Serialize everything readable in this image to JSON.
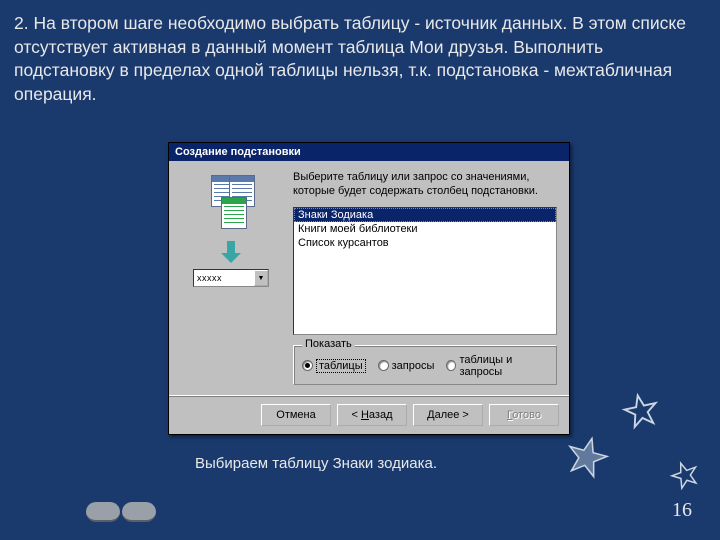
{
  "instruction": "2. На втором шаге необходимо выбрать таблицу - источник данных. В этом списке отсутствует активная в данный момент таблица Мои друзья. Выполнить подстановку в пределах одной таблицы нельзя, т.к. подстановка - межтабличная операция.",
  "dialog": {
    "title": "Создание подстановки",
    "prompt": "Выберите таблицу или запрос со значениями, которые будет содержать столбец подстановки.",
    "combo_placeholder": "xxxxx",
    "list": {
      "items": [
        "Знаки Зодиака",
        "Книги моей библиотеки",
        "Список курсантов"
      ],
      "selected_index": 0
    },
    "show_group": {
      "legend": "Показать",
      "options": [
        "таблицы",
        "запросы",
        "таблицы и запросы"
      ],
      "selected_index": 0
    },
    "buttons": {
      "cancel": "Отмена",
      "back": "< Назад",
      "next": "Далее >",
      "finish": "Готово"
    }
  },
  "caption": "Выбираем таблицу Знаки зодиака.",
  "page_number": "16"
}
